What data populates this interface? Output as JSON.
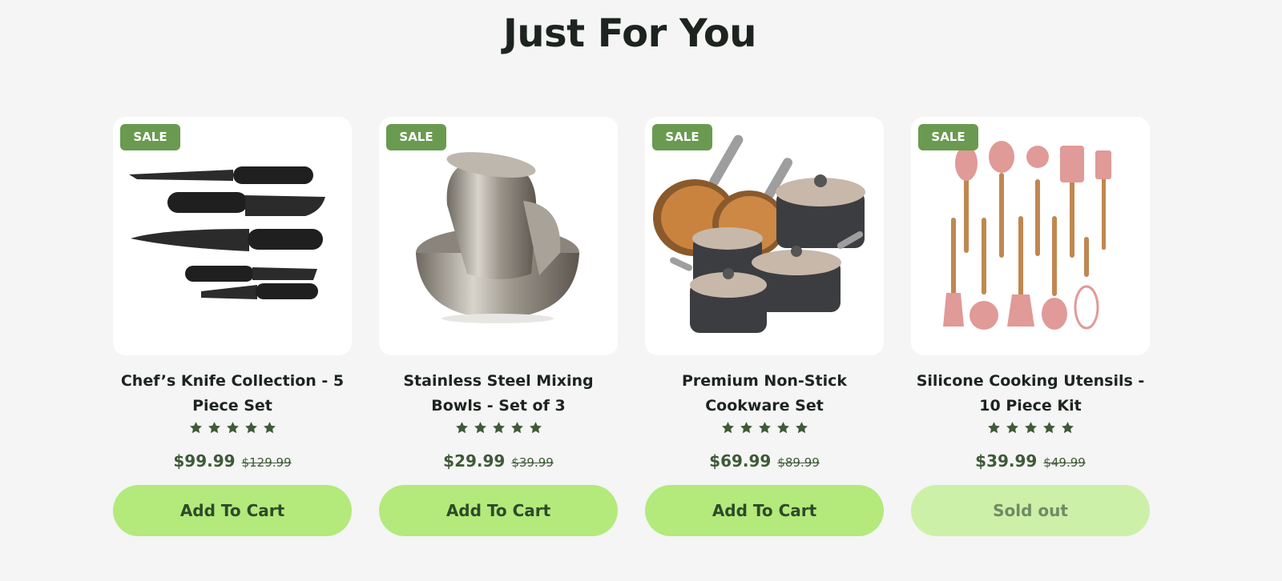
{
  "section": {
    "title": "Just For You"
  },
  "colors": {
    "badge": "#6a9a50",
    "button": "#b3ea7b",
    "button_disabled": "#cdf0a8",
    "price": "#3e5a37",
    "star": "#3e5a37"
  },
  "products": [
    {
      "badge": "SALE",
      "title": "Chef’s Knife Collection - 5 Piece Set",
      "rating": 5,
      "price": "$99.99",
      "compare_price": "$129.99",
      "button_label": "Add To Cart",
      "image_icon": "knife-set-icon",
      "available": true
    },
    {
      "badge": "SALE",
      "title": "Stainless Steel Mixing Bowls - Set of 3",
      "rating": 5,
      "price": "$29.99",
      "compare_price": "$39.99",
      "button_label": "Add To Cart",
      "image_icon": "mixing-bowls-icon",
      "available": true
    },
    {
      "badge": "SALE",
      "title": "Premium Non-Stick Cookware Set",
      "rating": 5,
      "price": "$69.99",
      "compare_price": "$89.99",
      "button_label": "Add To Cart",
      "image_icon": "cookware-set-icon",
      "available": true
    },
    {
      "badge": "SALE",
      "title": "Silicone Cooking Utensils - 10 Piece Kit",
      "rating": 5,
      "price": "$39.99",
      "compare_price": "$49.99",
      "button_label": "Sold out",
      "image_icon": "utensils-set-icon",
      "available": false
    }
  ]
}
